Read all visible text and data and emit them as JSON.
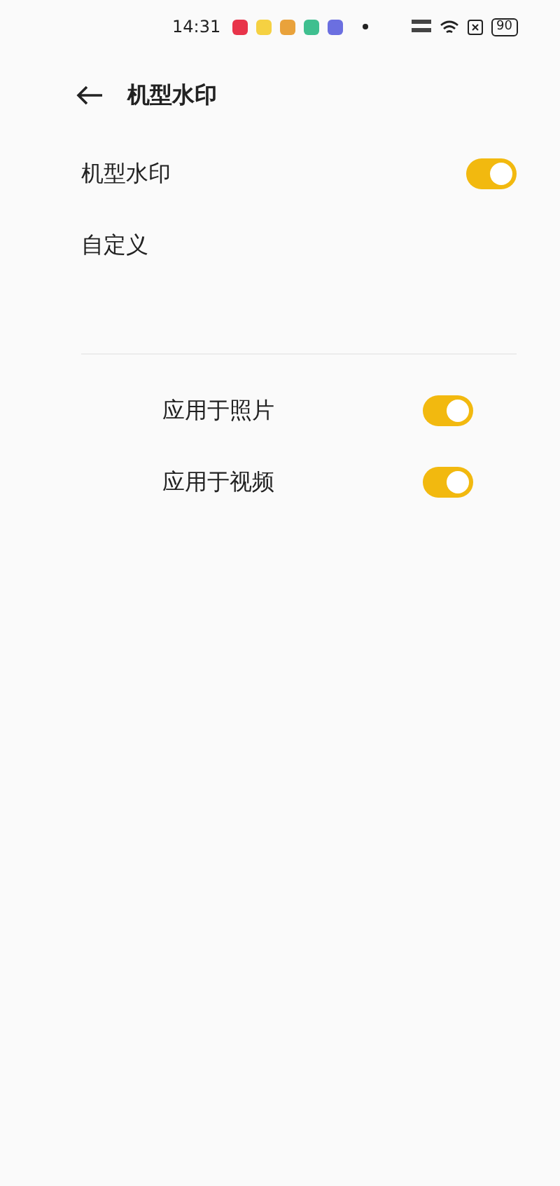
{
  "status_bar": {
    "time": "14:31",
    "app_icons": [
      {
        "color": "#e8344a"
      },
      {
        "color": "#f5d142"
      },
      {
        "color": "#e9a23b"
      },
      {
        "color": "#3fbf8f"
      },
      {
        "color": "#6b6fe0"
      }
    ],
    "battery": "90"
  },
  "header": {
    "title": "机型水印"
  },
  "sections": [
    {
      "items": [
        {
          "kind": "toggle",
          "label": "机型水印",
          "on": true
        },
        {
          "kind": "link",
          "label": "自定义"
        }
      ]
    },
    {
      "items": [
        {
          "kind": "toggle",
          "label": "应用于照片",
          "on": true
        },
        {
          "kind": "toggle",
          "label": "应用于视频",
          "on": true
        }
      ]
    }
  ]
}
